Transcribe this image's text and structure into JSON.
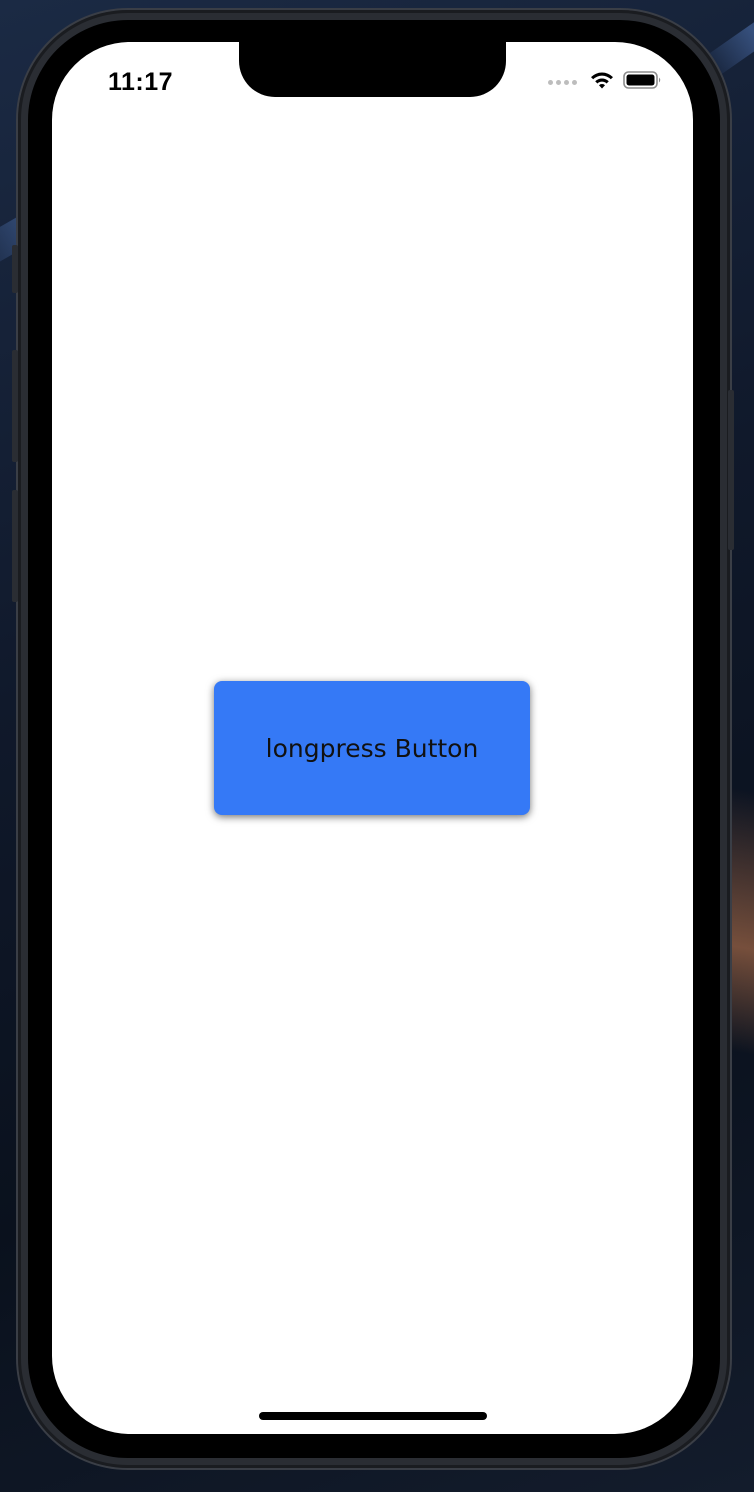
{
  "status_bar": {
    "time": "11:17",
    "icons": [
      "signal-dots-icon",
      "wifi-icon",
      "battery-icon"
    ]
  },
  "main": {
    "longpress_button_label": "longpress Button"
  },
  "colors": {
    "button_background": "#3579f6",
    "button_text": "#111111",
    "screen_background": "#ffffff"
  }
}
